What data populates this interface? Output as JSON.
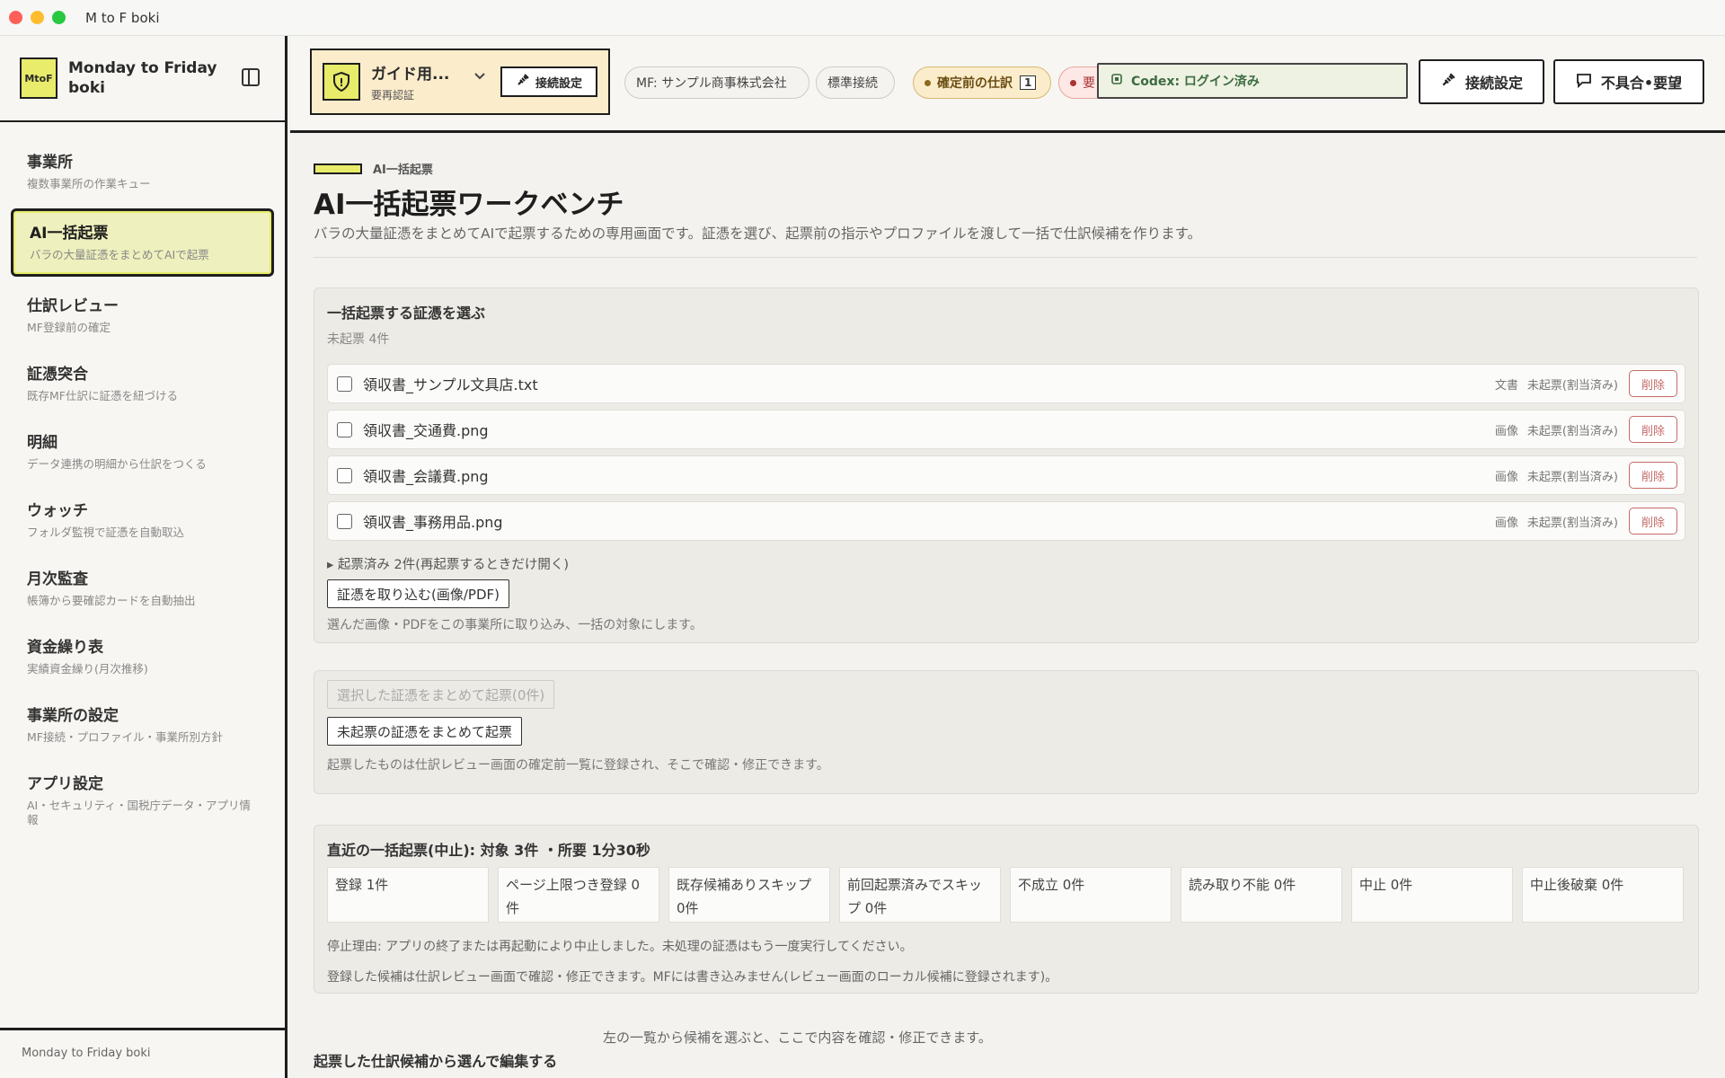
{
  "window": {
    "title": "M to F boki"
  },
  "sidebar": {
    "logo": "MtoF",
    "app_name": "Monday to Friday boki",
    "items": [
      {
        "label": "事業所",
        "sub": "複数事業所の作業キュー"
      },
      {
        "label": "AI一括起票",
        "sub": "バラの大量証憑をまとめてAIで起票"
      },
      {
        "label": "仕訳レビュー",
        "sub": "MF登録前の確定"
      },
      {
        "label": "証憑突合",
        "sub": "既存MF仕訳に証憑を紐づける"
      },
      {
        "label": "明細",
        "sub": "データ連携の明細から仕訳をつくる"
      },
      {
        "label": "ウォッチ",
        "sub": "フォルダ監視で証憑を自動取込"
      },
      {
        "label": "月次監査",
        "sub": "帳簿から要確認カードを自動抽出"
      },
      {
        "label": "資金繰り表",
        "sub": "実績資金繰り(月次推移)"
      },
      {
        "label": "事業所の設定",
        "sub": "MF接続・プロファイル・事業所別方針"
      },
      {
        "label": "アプリ設定",
        "sub": "AI・セキュリティ・国税庁データ・アプリ情報"
      }
    ],
    "footer": "Monday to Friday boki"
  },
  "topbar": {
    "guide_title": "ガイド用...",
    "guide_sub": "要再認証",
    "guide_conn": "接続設定",
    "pill_company": "MF: サンプル商事株式会社",
    "pill_standard": "標準接続",
    "pill_pending": "確定前の仕訳",
    "pill_pending_count": "1",
    "pill_red": "要",
    "codex": "Codex: ログイン済み",
    "conn_button": "接続設定",
    "feedback_button": "不具合•要望"
  },
  "main": {
    "eyebrow": "AI一括起票",
    "title": "AI一括起票ワークベンチ",
    "lead": "バラの大量証憑をまとめてAIで起票するための専用画面です。証憑を選び、起票前の指示やプロファイルを渡して一括で仕訳候補を作ります。",
    "select_card": {
      "title": "一括起票する証憑を選ぶ",
      "count": "未起票 4件",
      "files": [
        {
          "name": "領収書_サンプル文具店.txt",
          "type": "文書",
          "status": "未起票(割当済み)",
          "delete": "削除"
        },
        {
          "name": "領収書_交通費.png",
          "type": "画像",
          "status": "未起票(割当済み)",
          "delete": "削除"
        },
        {
          "name": "領収書_会議費.png",
          "type": "画像",
          "status": "未起票(割当済み)",
          "delete": "削除"
        },
        {
          "name": "領収書_事務用品.png",
          "type": "画像",
          "status": "未起票(割当済み)",
          "delete": "削除"
        }
      ],
      "done_toggle": "▸ 起票済み 2件(再起票するときだけ開く)",
      "import_button": "証憑を取り込む(画像/PDF)",
      "import_note": "選んだ画像・PDFをこの事業所に取り込み、一括の対象にします。"
    },
    "action_card": {
      "selected_button": "選択した証憑をまとめて起票(0件)",
      "all_button": "未起票の証憑をまとめて起票",
      "note": "起票したものは仕訳レビュー画面の確定前一覧に登録され、そこで確認・修正できます。"
    },
    "recent_card": {
      "title": "直近の一括起票(中止): 対象 3件 ・所要 1分30秒",
      "stats": [
        "登録 1件",
        "ページ上限つき登録 0件",
        "既存候補ありスキップ 0件",
        "前回起票済みでスキップ 0件",
        "不成立 0件",
        "読み取り不能 0件",
        "中止 0件",
        "中止後破棄 0件"
      ],
      "stop_reason": "停止理由: アプリの終了または再起動により中止しました。未処理の証憑はもう一度実行してください。",
      "note": "登録した候補は仕訳レビュー画面で確認・修正できます。MFには書き込みません(レビュー画面のローカル候補に登録されます)。"
    },
    "bottom_hint": "左の一覧から候補を選ぶと、ここで内容を確認・修正できます。",
    "bottom_heading": "起票した仕訳候補から選んで編集する"
  },
  "colors": {
    "accent": "#e8ec6a",
    "ink": "#1e1e1e",
    "warn_bg": "#fbeccb",
    "danger": "#c46b68",
    "success": "#3c6b42"
  },
  "icons": [
    "shield-icon",
    "plug-icon",
    "chat-icon",
    "chevron-down-icon",
    "sidebar-toggle-icon",
    "chip-icon"
  ]
}
